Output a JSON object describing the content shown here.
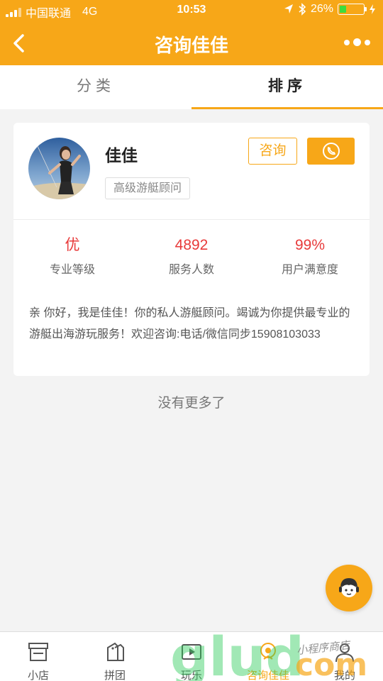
{
  "status_bar": {
    "carrier": "中国联通",
    "network": "4G",
    "time": "10:53",
    "battery": "26%"
  },
  "nav": {
    "title": "咨询佳佳"
  },
  "tabs": [
    {
      "label": "分类"
    },
    {
      "label": "排序"
    }
  ],
  "consultant": {
    "name": "佳佳",
    "tag": "高级游艇顾问",
    "consult_label": "咨询",
    "stats": [
      {
        "value": "优",
        "label": "专业等级"
      },
      {
        "value": "4892",
        "label": "服务人数"
      },
      {
        "value": "99%",
        "label": "用户满意度"
      }
    ],
    "description": "亲 你好，我是佳佳！你的私人游艇顾问。竭诚为你提供最专业的游艇出海游玩服务！欢迎咨询:电话/微信同步15908103033"
  },
  "list_end": "没有更多了",
  "tabbar": [
    {
      "label": "小店",
      "icon": "shop-icon"
    },
    {
      "label": "拼团",
      "icon": "group-tag-icon"
    },
    {
      "label": "玩乐",
      "icon": "play-icon"
    },
    {
      "label": "咨询佳佳",
      "icon": "consult-icon"
    },
    {
      "label": "我的",
      "icon": "user-icon"
    }
  ],
  "watermark": {
    "text": "glud com",
    "subtext": "小程序商店"
  },
  "colors": {
    "accent": "#f7a718",
    "stat_value": "#e83a3a",
    "background": "#f3f3f3"
  }
}
